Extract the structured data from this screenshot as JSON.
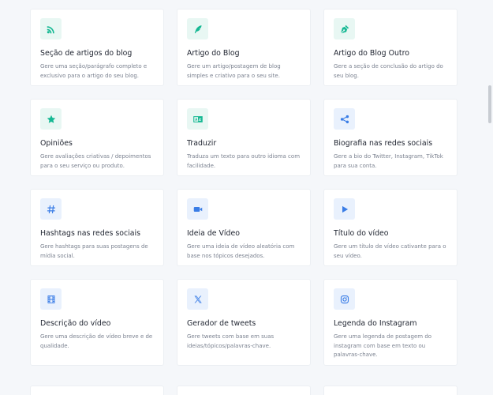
{
  "cards": [
    {
      "title": "Seção de artigos do blog",
      "desc": "Gere uma seção/parágrafo completo e exclusivo para o artigo do seu blog.",
      "icon": "rss-icon",
      "color": "teal"
    },
    {
      "title": "Artigo do Blog",
      "desc": "Gere um artigo/postagem de blog simples e criativo para o seu site.",
      "icon": "pen-icon",
      "color": "teal"
    },
    {
      "title": "Artigo do Blog Outro",
      "desc": "Gere a seção de conclusão do artigo do seu blog.",
      "icon": "pen-nib-icon",
      "color": "teal"
    },
    {
      "title": "Opiniões",
      "desc": "Gere avaliações criativas / depoimentos para o seu serviço ou produto.",
      "icon": "star-icon",
      "color": "teal"
    },
    {
      "title": "Traduzir",
      "desc": "Traduza um texto para outro idioma com facilidade.",
      "icon": "language-icon",
      "color": "teal"
    },
    {
      "title": "Biografia nas redes sociais",
      "desc": "Gere a bio do Twitter, Instagram, TikTok para sua conta.",
      "icon": "share-icon",
      "color": "blue"
    },
    {
      "title": "Hashtags nas redes sociais",
      "desc": "Gere hashtags para suas postagens de mídia social.",
      "icon": "hashtag-icon",
      "color": "blue"
    },
    {
      "title": "Ideia de Vídeo",
      "desc": "Gere uma ideia de vídeo aleatória com base nos tópicos desejados.",
      "icon": "video-camera-icon",
      "color": "blue"
    },
    {
      "title": "Título do vídeo",
      "desc": "Gere um título de vídeo cativante para o seu vídeo.",
      "icon": "play-icon",
      "color": "blue"
    },
    {
      "title": "Descrição do vídeo",
      "desc": "Gere uma descrição de vídeo breve e de qualidade.",
      "icon": "film-icon",
      "color": "blue"
    },
    {
      "title": "Gerador de tweets",
      "desc": "Gere tweets com base em suas ideias/tópicos/palavras-chave.",
      "icon": "x-twitter-icon",
      "color": "blue"
    },
    {
      "title": "Legenda do Instagram",
      "desc": "Gere uma legenda de postagem do instagram com base em texto ou palavras-chave.",
      "icon": "instagram-icon",
      "color": "blue"
    }
  ],
  "colors": {
    "teal": "#15b893",
    "teal_bg": "#e8f7f3",
    "blue": "#3a7de6",
    "blue_bg": "#e9f1fd",
    "background": "#f5f7fa"
  }
}
